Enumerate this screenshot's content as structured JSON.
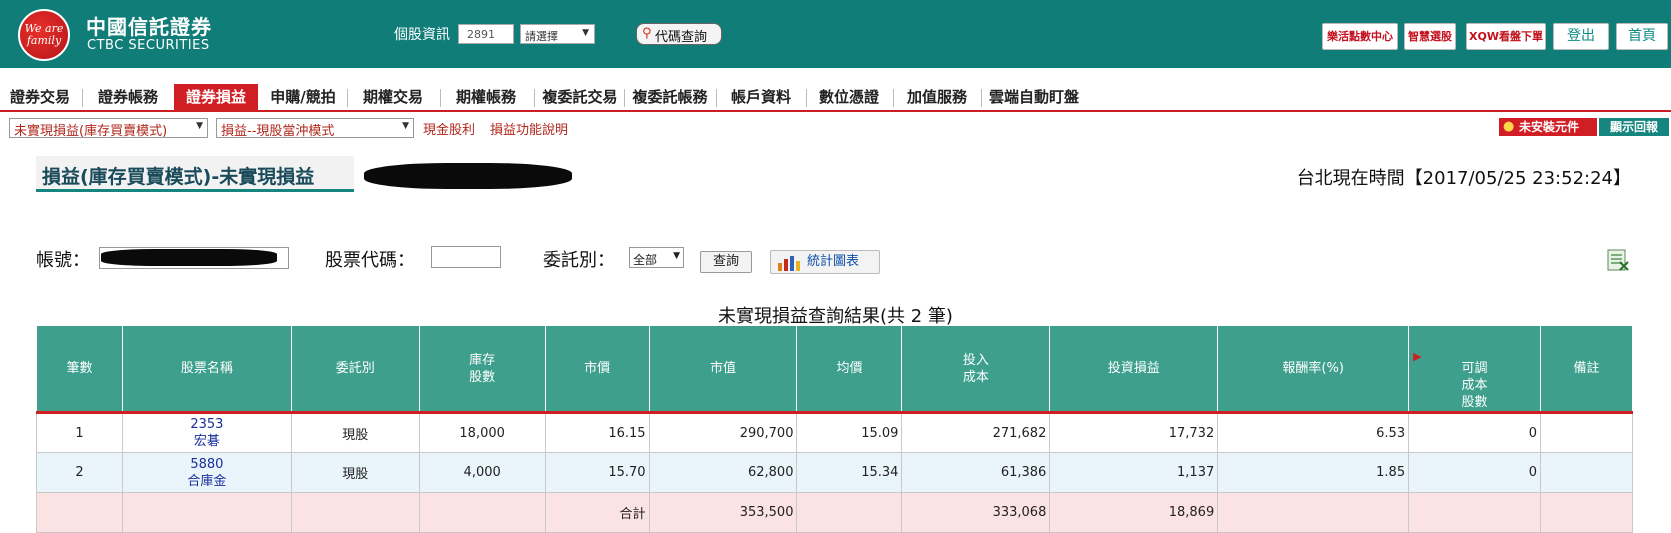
{
  "header": {
    "logo_text": "We are family",
    "brand_zh": "中國信託證券",
    "brand_en": "CTBC SECURITIES",
    "stock_info_label": "個股資訊",
    "stock_input_placeholder": "2891",
    "select_label": "請選擇",
    "code_lookup_label": "代碼查詢",
    "buttons": [
      "樂活點數中心",
      "智慧選股",
      "XQW看盤下單",
      "登出",
      "首頁"
    ]
  },
  "nav": {
    "items": [
      "證券交易",
      "證券帳務",
      "證券損益",
      "申購/競拍",
      "期權交易",
      "期權帳務",
      "複委託交易",
      "複委託帳務",
      "帳戶資料",
      "數位憑證",
      "加值服務",
      "雲端自動盯盤"
    ],
    "active": "證券損益"
  },
  "subbar": {
    "select1": "未實現損益(庫存買賣模式)",
    "select2": "損益--現股當沖模式",
    "link1": "現金股利",
    "link2": "損益功能說明",
    "warn_label": "未安裝元件",
    "report_label": "顯示回報"
  },
  "page": {
    "title": "損益(庫存買賣模式)-未實現損益",
    "clock": "台北現在時間【2017/05/25 23:52:24】"
  },
  "query": {
    "account_label": "帳號：",
    "stock_code_label": "股票代碼：",
    "order_type_label": "委託別：",
    "order_type_value": "全部",
    "query_btn": "查詢",
    "chart_btn": "統計圖表"
  },
  "result": {
    "caption": "未實現損益查詢結果(共 2 筆)",
    "columns": [
      "筆數",
      "股票名稱",
      "委託別",
      "庫存\n股數",
      "市價",
      "市值",
      "均價",
      "投入\n成本",
      "投資損益",
      "報酬率(%)",
      "可調\n成本\n股數",
      "備註"
    ],
    "rows": [
      {
        "no": "1",
        "code": "2353",
        "name": "宏碁",
        "type": "現股",
        "qty": "18,000",
        "price": "16.15",
        "mkt_value": "290,700",
        "avg": "15.09",
        "cost": "271,682",
        "pnl": "17,732",
        "ret": "6.53",
        "adj": "0",
        "note": ""
      },
      {
        "no": "2",
        "code": "5880",
        "name": "合庫金",
        "type": "現股",
        "qty": "4,000",
        "price": "15.70",
        "mkt_value": "62,800",
        "avg": "15.34",
        "cost": "61,386",
        "pnl": "1,137",
        "ret": "1.85",
        "adj": "0",
        "note": ""
      }
    ],
    "total": {
      "label": "合計",
      "mkt_value": "353,500",
      "cost": "333,068",
      "pnl": "18,869"
    }
  }
}
